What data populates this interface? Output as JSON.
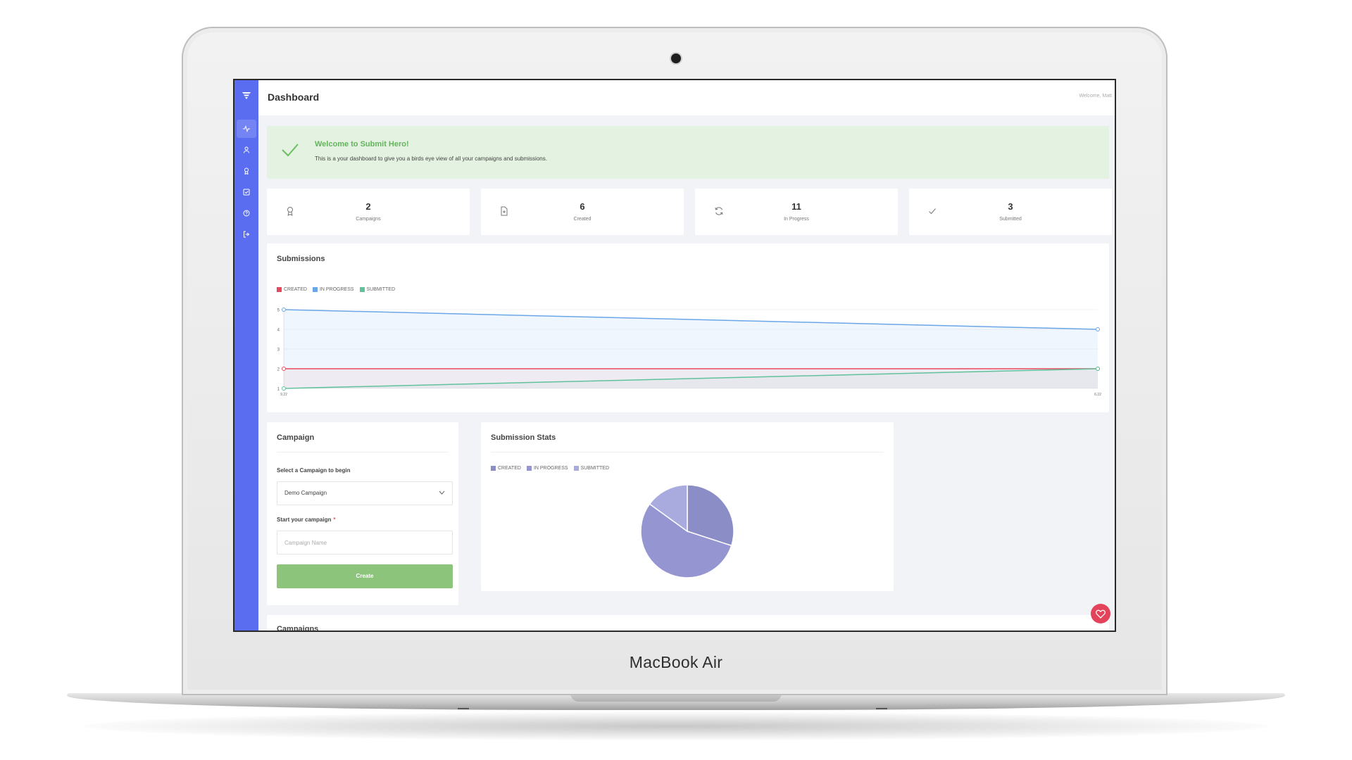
{
  "device": {
    "model_label": "MacBook Air"
  },
  "app": {
    "page_title": "Dashboard",
    "welcome_text": "Welcome, Matt",
    "sidebar": {
      "logo_icon": "submit-hero-logo",
      "items": [
        {
          "icon": "activity-icon",
          "active": true
        },
        {
          "icon": "user-icon"
        },
        {
          "icon": "award-icon"
        },
        {
          "icon": "check-square-icon"
        },
        {
          "icon": "help-circle-icon"
        },
        {
          "icon": "log-out-icon"
        }
      ]
    },
    "alert": {
      "title": "Welcome to Submit Hero!",
      "text": "This is a your dashboard to give you a birds eye view of all your campaigns and submissions."
    },
    "stats": [
      {
        "icon": "award-icon",
        "value": "2",
        "label": "Campaigns"
      },
      {
        "icon": "file-icon",
        "value": "6",
        "label": "Created"
      },
      {
        "icon": "refresh-icon",
        "value": "11",
        "label": "In Progress"
      },
      {
        "icon": "check-icon",
        "value": "3",
        "label": "Submitted"
      }
    ],
    "submissions": {
      "title": "Submissions"
    },
    "campaign_form": {
      "title": "Campaign",
      "select_label": "Select a Campaign to begin",
      "select_value": "Demo Campaign",
      "start_label": "Start your campaign",
      "required_mark": "*",
      "name_placeholder": "Campaign Name",
      "create_label": "Create"
    },
    "stats_card": {
      "title": "Submission Stats"
    },
    "campaigns_heading": "Campaigns",
    "colors": {
      "sidebar": "#5a6df0",
      "success": "#8cc47c",
      "heart": "#e2445c"
    }
  },
  "chart_data": [
    {
      "type": "line",
      "title": "Submissions",
      "x": [
        "9.22",
        "6.22"
      ],
      "yticks": [
        1,
        2,
        3,
        4,
        5
      ],
      "ylim": [
        1,
        5
      ],
      "legend_position": "top-left",
      "series": [
        {
          "name": "CREATED",
          "color": "#e8485d",
          "values": [
            2,
            2
          ]
        },
        {
          "name": "IN PROGRESS",
          "color": "#6aa6e8",
          "values": [
            5,
            4
          ]
        },
        {
          "name": "SUBMITTED",
          "color": "#5fc29b",
          "values": [
            1,
            2
          ]
        }
      ]
    },
    {
      "type": "pie",
      "title": "Submission Stats",
      "legend_position": "top-left",
      "series": [
        {
          "name": "CREATED",
          "color": "#8b8dc7",
          "value": 6
        },
        {
          "name": "IN PROGRESS",
          "color": "#9495d1",
          "value": 11
        },
        {
          "name": "SUBMITTED",
          "color": "#a9aade",
          "value": 3
        }
      ]
    }
  ]
}
